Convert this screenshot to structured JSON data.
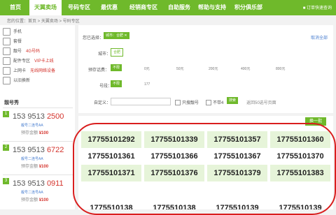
{
  "nav": {
    "items": [
      "首页",
      "天翼卖场",
      "号码专区",
      "最优惠",
      "经销商专区",
      "自助服务",
      "帮助与支持",
      "积分俱乐部"
    ],
    "right": "订单快速查询"
  },
  "breadcrumb": "您的位置：首页 > 天翼卖场 > 号码专区",
  "sidebar": {
    "items": [
      {
        "label": "手机",
        "tag": ""
      },
      {
        "label": "套餐",
        "tag": ""
      },
      {
        "label": "靓号",
        "tag": "4G号码"
      },
      {
        "label": "配件专区",
        "tag": "VIP卡上线"
      },
      {
        "label": "上网卡",
        "tag": "无线网络设备"
      },
      {
        "label": "以旧换新",
        "tag": ""
      }
    ]
  },
  "ranking": {
    "title": "靓号秀",
    "items": [
      {
        "rank": "1",
        "prefix": "153 9513 ",
        "hi": "2500",
        "sub": "靓号二连号AA",
        "price_label": "预存金额",
        "price": "¥100"
      },
      {
        "rank": "2",
        "prefix": "153 9513 ",
        "hi": "6722",
        "sub": "靓号二连号AA",
        "price_label": "预存金额",
        "price": "¥100"
      },
      {
        "rank": "3",
        "prefix": "153 9513 ",
        "hi": "0911",
        "sub": "靓号二连号AA",
        "price_label": "预存金额",
        "price": "¥100"
      }
    ]
  },
  "filter": {
    "selected_label": "您已选择：",
    "selected_chip": "城市：合肥 ✕",
    "clear": "取消全部",
    "city_label": "城市：",
    "city_value": "合肥",
    "deposit_label": "预存话费：",
    "deposit_value": "不限",
    "deposit_options": [
      "0元",
      "50元",
      "200元",
      "400元",
      "800元"
    ],
    "segment_label": "号段：",
    "segment_value": "不限",
    "segment_option": "177",
    "custom_label": "自定义：",
    "only_good": "只搜靓号",
    "no_four": "不带4",
    "search_btn": "搜索",
    "hint": "返回50选号页面"
  },
  "results": {
    "button": "换一批",
    "rows": [
      [
        "17755101292",
        "17755101339",
        "17755101357",
        "17755101360"
      ],
      [
        "17755101361",
        "17755101366",
        "17755101367",
        "17755101370"
      ],
      [
        "17755101371",
        "17755101376",
        "17755101379",
        "17755101383"
      ]
    ],
    "row_colors": [
      "#e6f4d9",
      "#ffffff",
      "#e6f4d9"
    ],
    "partial_row": [
      "1775510138",
      "1775510138",
      "1775510139",
      "1775510139"
    ]
  },
  "colors": {
    "accent": "#6fb92b",
    "highlight": "#d91e1e"
  }
}
